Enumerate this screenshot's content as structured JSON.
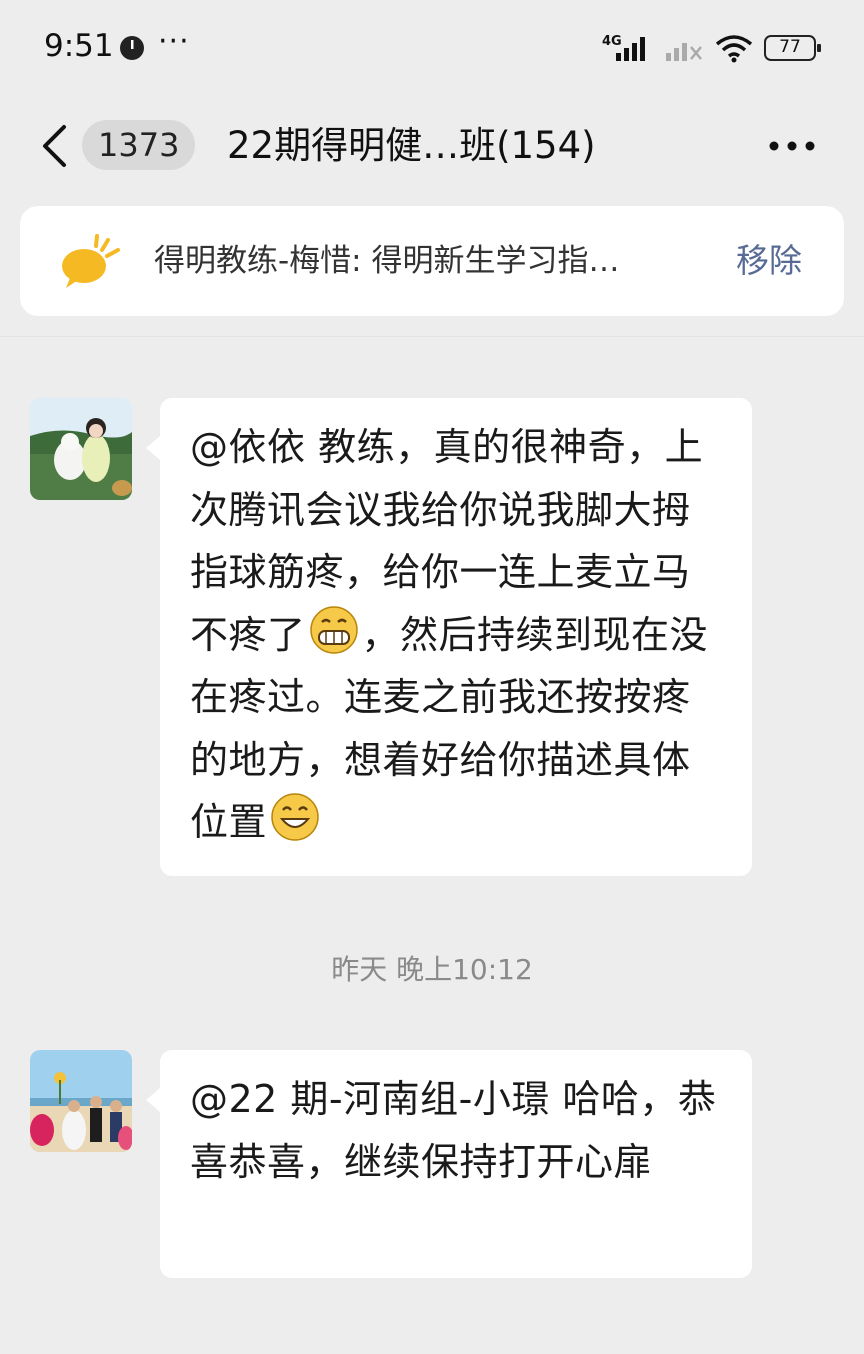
{
  "status_bar": {
    "time": "9:51",
    "dots": "···",
    "network": "4G",
    "battery": "77"
  },
  "nav": {
    "unread_count": "1373",
    "title": "22期得明健…班(154)"
  },
  "pinned": {
    "text": "得明教练-梅惜: 得明新生学习指…",
    "remove_label": "移除"
  },
  "messages": [
    {
      "segments": [
        "@依依  教练，真的很神奇，上次腾讯会议我给你说我脚大拇指球筋疼，给你一连上麦立马不疼了",
        "，然后持续到现在没在疼过。连麦之前我还按按疼的地方，想着好给你描述具体位置"
      ],
      "emojis": [
        "grin-emoji",
        "smile-emoji"
      ]
    },
    {
      "text": "@22 期-河南组-小璟  哈哈，恭喜恭喜，继续保持打开心扉"
    }
  ],
  "timestamp": "昨天 晚上10:12",
  "colors": {
    "background": "#ededed",
    "bubble": "#ffffff",
    "link_blue": "#576b95",
    "pin_icon": "#f5b924"
  }
}
